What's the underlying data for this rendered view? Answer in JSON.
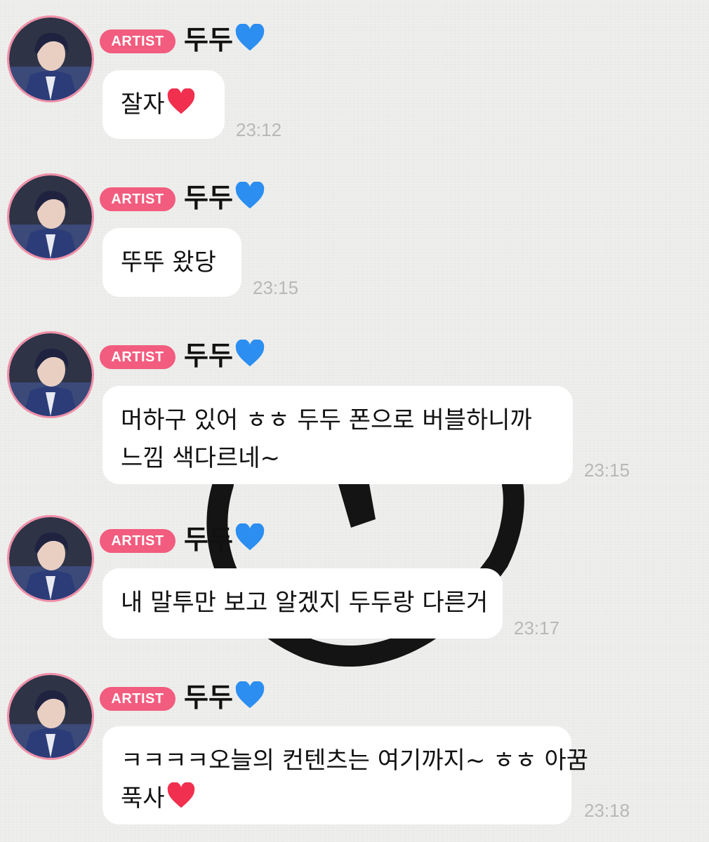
{
  "colors": {
    "badge": "#f25c7e",
    "avatar_ring": "#f08fa8",
    "bubble": "#ffffff",
    "time": "#b8b8b8"
  },
  "messages": [
    {
      "badge": "ARTIST",
      "name": "두두",
      "name_icon": "blue-heart-icon",
      "text": "잘자",
      "text_icon": "red-heart-icon",
      "time": "23:12"
    },
    {
      "badge": "ARTIST",
      "name": "두두",
      "name_icon": "blue-heart-icon",
      "text": "뚜뚜 왔당",
      "time": "23:15"
    },
    {
      "badge": "ARTIST",
      "name": "두두",
      "name_icon": "blue-heart-icon",
      "text_line1": "머하구 있어 ㅎㅎ 두두 폰으로 버블하니까",
      "text_line2": "느낌 색다르네~",
      "time": "23:15"
    },
    {
      "badge": "ARTIST",
      "name": "두두",
      "name_icon": "blue-heart-icon",
      "text": "내 말투만 보고 알겠지 두두랑 다른거",
      "time": "23:17"
    },
    {
      "badge": "ARTIST",
      "name": "두두",
      "name_icon": "blue-heart-icon",
      "text_line1": "ㅋㅋㅋㅋ오늘의 컨텐츠는 여기까지~ ㅎㅎ 아꿈",
      "text_line2": "푹사",
      "text_icon": "red-heart-icon",
      "time": "23:18"
    }
  ]
}
